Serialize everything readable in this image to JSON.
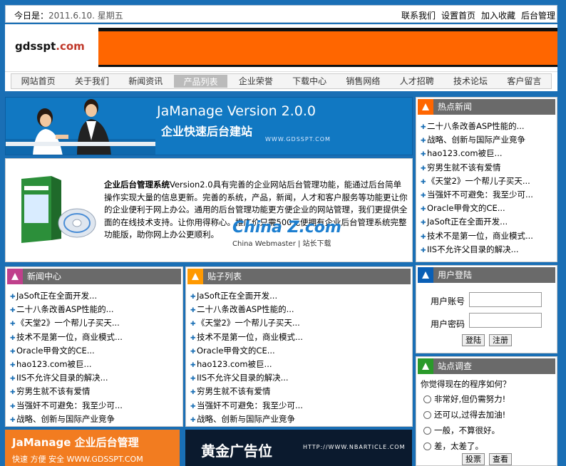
{
  "topbar": {
    "date_label": "今日是：",
    "date_value": "2011.6.10. 星期五",
    "links": [
      "联系我们",
      "设置首页",
      "加入收藏",
      "后台管理"
    ]
  },
  "header": {
    "logo_main": "gdsspt",
    "logo_com": ".com"
  },
  "nav": {
    "items": [
      "网站首页",
      "关于我们",
      "新闻资讯",
      "产品列表",
      "企业荣誉",
      "下载中心",
      "销售网络",
      "人才招聘",
      "技术论坛",
      "客户留言"
    ],
    "active_index": 3
  },
  "banner": {
    "title": "JaManage Version 2.0.0",
    "subtitle": "企业快速后台建站",
    "url": "WWW.GDSSPT.COM"
  },
  "intro": {
    "product_name": "企业后台管理系统",
    "text": "Version2.0具有完善的企业网站后台管理功能，能通过后台简单操作实现大量的信息更新。完善的系统，产品，新闻，人才和客户服务等功能更让你的企业便利于网上办公。通用的后台管理功能更方便企业的网站管理，我们更提供全面的在线技术支持。让你用得称心。推广价只需500元便拥有企业后台管理系统完整功能版，助你网上办公更顺利。",
    "watermark": "China Z.com",
    "footer": "China Webmaster | 站长下载"
  },
  "hot_news": {
    "title": "热点新闻",
    "items": [
      "二十八条改善ASP性能的...",
      "战略、创新与国际产业竞争",
      "hao123.com被巨...",
      "穷男生就不该有爱情",
      "《天堂2》一个帮儿子买天...",
      "当强奸不可避免：我至少可...",
      "Oracle甲骨文的CE...",
      "JaSoft正在全面开发...",
      "技术不是第一位，商业模式...",
      "IIS不允许父目录的解决..."
    ]
  },
  "news_center": {
    "title": "新闻中心",
    "items": [
      "JaSoft正在全面开发...",
      "二十八条改善ASP性能的...",
      "《天堂2》一个帮儿子买天...",
      "技术不是第一位，商业模式...",
      "Oracle甲骨文的CE...",
      "hao123.com被巨...",
      "IIS不允许父目录的解决...",
      "穷男生就不该有爱情",
      "当强奸不可避免：我至少可...",
      "战略、创新与国际产业竞争"
    ]
  },
  "post_list": {
    "title": "贴子列表",
    "items": [
      "JaSoft正在全面开发...",
      "二十八条改善ASP性能的...",
      "《天堂2》一个帮儿子买天...",
      "技术不是第一位，商业模式...",
      "Oracle甲骨文的CE...",
      "hao123.com被巨...",
      "IIS不允许父目录的解决...",
      "穷男生就不该有爱情",
      "当强奸不可避免：我至少可...",
      "战略、创新与国际产业竞争"
    ]
  },
  "login": {
    "title": "用户登陆",
    "account_label": "用户账号",
    "password_label": "用户密码",
    "login_button": "登陆",
    "register_button": "注册"
  },
  "survey": {
    "title": "站点调查",
    "question": "你觉得现在的程序如何？",
    "options": [
      "非常好,但仍需努力!",
      "还可以,过得去加油!",
      "一般，不算很好。",
      "差，太差了。"
    ],
    "vote_button": "投票",
    "view_button": "查看"
  },
  "ads": {
    "ad1_title": "JaManage 企业后台管理",
    "ad1_sub": "快速  方便  安全  WWW.GDSSPT.COM",
    "ad2_title": "黄金广告位",
    "ad2_url": "HTTP://WWW.NBARTICLE.COM"
  },
  "colors": {
    "page_bg": "#1a6fb5",
    "accent": "#ff6600",
    "header_gray": "#6a6a6a",
    "hot": "#ff6600",
    "news": "#c0408c",
    "post": "#ff9900",
    "login": "#0a5fb5",
    "survey": "#2a9a2a"
  }
}
